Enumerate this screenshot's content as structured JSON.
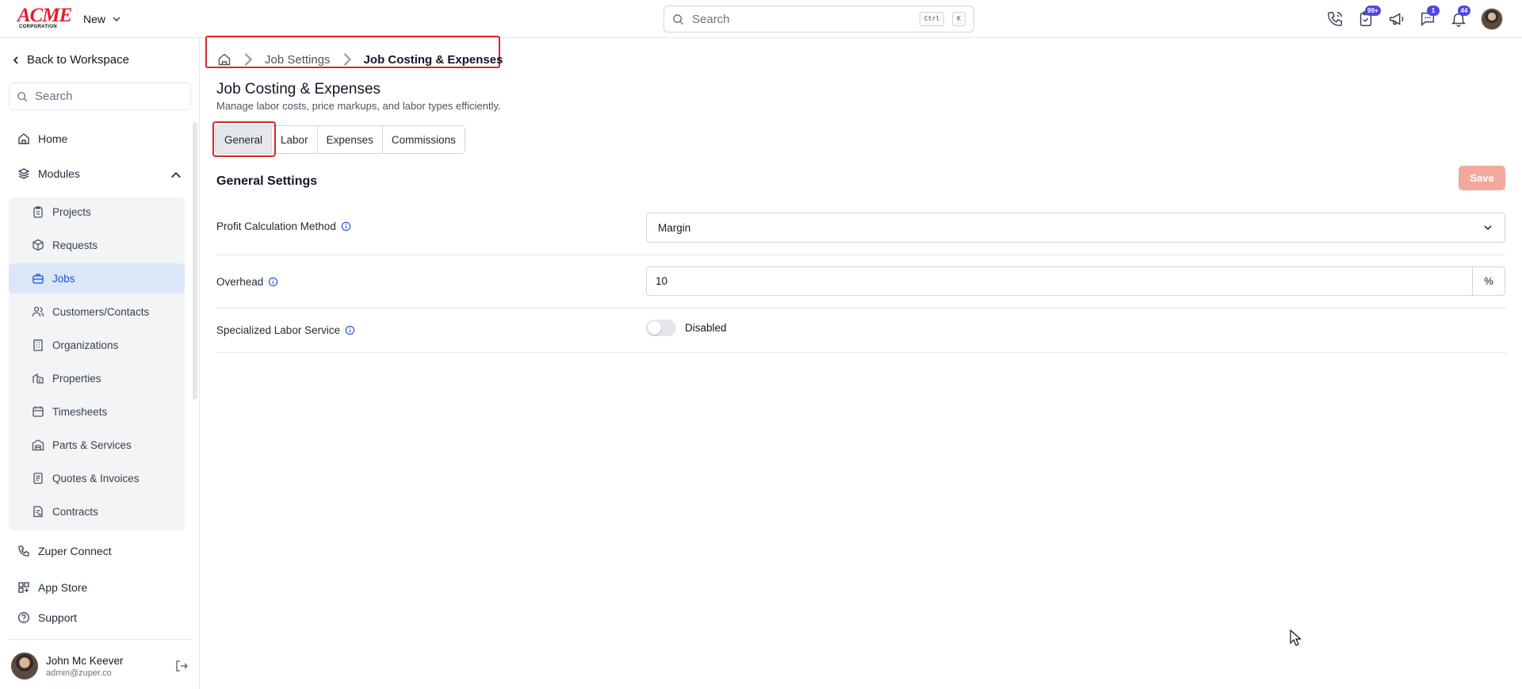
{
  "brand": {
    "logo_main": "ACME",
    "logo_sub": "CORPORATION"
  },
  "topbar": {
    "new_label": "New",
    "search": {
      "placeholder": "Search",
      "shortcut_1": "Ctrl",
      "shortcut_2": "K"
    },
    "badges": {
      "tasks": "99+",
      "chat": "1",
      "notifications": "44"
    }
  },
  "sidebar": {
    "back_label": "Back to Workspace",
    "search_placeholder": "Search",
    "home_label": "Home",
    "modules_label": "Modules",
    "modules": [
      {
        "label": "Projects",
        "icon": "clipboard-icon"
      },
      {
        "label": "Requests",
        "icon": "box-icon"
      },
      {
        "label": "Jobs",
        "icon": "briefcase-icon",
        "active": true
      },
      {
        "label": "Customers/Contacts",
        "icon": "users-icon"
      },
      {
        "label": "Organizations",
        "icon": "building-icon"
      },
      {
        "label": "Properties",
        "icon": "property-icon"
      },
      {
        "label": "Timesheets",
        "icon": "calendar-icon"
      },
      {
        "label": "Parts & Services",
        "icon": "warehouse-icon"
      },
      {
        "label": "Quotes & Invoices",
        "icon": "invoice-icon"
      },
      {
        "label": "Contracts",
        "icon": "contract-icon"
      }
    ],
    "connect_label": "Zuper Connect",
    "appstore_label": "App Store",
    "support_label": "Support",
    "user": {
      "name": "John Mc Keever",
      "email": "admin@zuper.co"
    }
  },
  "breadcrumb": {
    "parent": "Job Settings",
    "current": "Job Costing & Expenses"
  },
  "page": {
    "title": "Job Costing & Expenses",
    "subtitle": "Manage labor costs, price markups, and labor types efficiently.",
    "tabs": [
      {
        "label": "General",
        "active": true
      },
      {
        "label": "Labor"
      },
      {
        "label": "Expenses"
      },
      {
        "label": "Commissions"
      }
    ]
  },
  "settings": {
    "section_title": "General Settings",
    "save_label": "Save",
    "profit_label": "Profit Calculation Method",
    "profit_value": "Margin",
    "overhead_label": "Overhead",
    "overhead_value": "10",
    "overhead_unit": "%",
    "specialized_label": "Specialized Labor Service",
    "specialized_status": "Disabled"
  },
  "colors": {
    "accent": "#1d4ed8",
    "highlight": "#dc2626",
    "save_disabled": "#f2a99b",
    "badge": "#4f46e5"
  }
}
